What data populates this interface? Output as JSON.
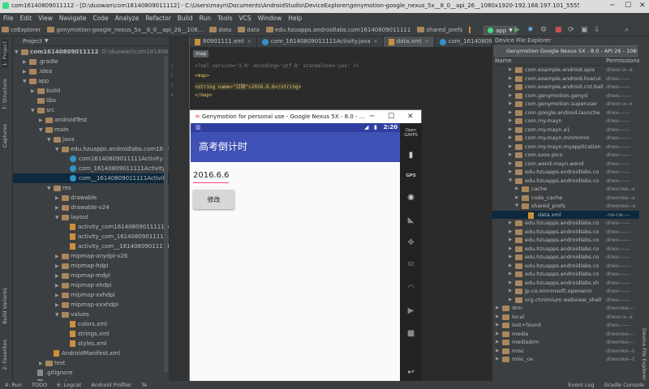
{
  "window_title": "com16140809011112 - [D:\\duowan\\com16140809011112] - C:\\Users\\mayn\\Documents\\AndroidStudio\\DeviceExplorer\\genymotion-google_nexus_5x__8_0__api_26__1080x1920-192.168.197.101_5555\\data\\data\\edu...",
  "menu": [
    "File",
    "Edit",
    "View",
    "Navigate",
    "Code",
    "Analyze",
    "Refactor",
    "Build",
    "Run",
    "Tools",
    "VCS",
    "Window",
    "Help"
  ],
  "nav": [
    "ceExplorer",
    "genymotion-google_nexus_5x__8_0__api_26__108...",
    "data",
    "data",
    "edu.hzuapps.androidlabs.com16140809011111",
    "shared_prefs",
    "data.xml"
  ],
  "run_config": "app",
  "project": {
    "header": "Project",
    "items": [
      {
        "label": "com16140809011112",
        "extra": "D:\\duowan\\com16140809011112",
        "depth": 0,
        "arrow": "▼",
        "icon": "folder"
      },
      {
        "label": ".gradle",
        "depth": 1,
        "arrow": "▶",
        "icon": "folder"
      },
      {
        "label": ".idea",
        "depth": 1,
        "arrow": "▶",
        "icon": "folder"
      },
      {
        "label": "app",
        "depth": 1,
        "arrow": "▼",
        "icon": "folder"
      },
      {
        "label": "build",
        "depth": 2,
        "arrow": "▶",
        "icon": "folder"
      },
      {
        "label": "libs",
        "depth": 2,
        "arrow": "",
        "icon": "folder"
      },
      {
        "label": "src",
        "depth": 2,
        "arrow": "▼",
        "icon": "folder"
      },
      {
        "label": "androidTest",
        "depth": 3,
        "arrow": "▶",
        "icon": "folder"
      },
      {
        "label": "main",
        "depth": 3,
        "arrow": "▼",
        "icon": "folder"
      },
      {
        "label": "java",
        "depth": 4,
        "arrow": "▼",
        "icon": "folder"
      },
      {
        "label": "edu.hzuapps.androidlabs.com16140809011",
        "depth": 5,
        "arrow": "▼",
        "icon": "folder"
      },
      {
        "label": "com16140809011111Activity",
        "depth": 6,
        "arrow": "",
        "icon": "class"
      },
      {
        "label": "com_16140809011111Activity",
        "depth": 6,
        "arrow": "",
        "icon": "class"
      },
      {
        "label": "com__16140809011111Activity",
        "depth": 6,
        "arrow": "",
        "icon": "class",
        "selected": true
      },
      {
        "label": "res",
        "depth": 4,
        "arrow": "▼",
        "icon": "folder"
      },
      {
        "label": "drawable",
        "depth": 5,
        "arrow": "▶",
        "icon": "folder"
      },
      {
        "label": "drawable-v24",
        "depth": 5,
        "arrow": "▶",
        "icon": "folder"
      },
      {
        "label": "layout",
        "depth": 5,
        "arrow": "▼",
        "icon": "folder"
      },
      {
        "label": "activity_com16140809011111.xm",
        "depth": 6,
        "arrow": "",
        "icon": "xml"
      },
      {
        "label": "activity_com_16140809011111.xm",
        "depth": 6,
        "arrow": "",
        "icon": "xml"
      },
      {
        "label": "activity_com__16140809011111.x",
        "depth": 6,
        "arrow": "",
        "icon": "xml"
      },
      {
        "label": "mipmap-anydpi-v26",
        "depth": 5,
        "arrow": "▶",
        "icon": "folder"
      },
      {
        "label": "mipmap-hdpi",
        "depth": 5,
        "arrow": "▶",
        "icon": "folder"
      },
      {
        "label": "mipmap-mdpi",
        "depth": 5,
        "arrow": "▶",
        "icon": "folder"
      },
      {
        "label": "mipmap-xhdpi",
        "depth": 5,
        "arrow": "▶",
        "icon": "folder"
      },
      {
        "label": "mipmap-xxhdpi",
        "depth": 5,
        "arrow": "▶",
        "icon": "folder"
      },
      {
        "label": "mipmap-xxxhdpi",
        "depth": 5,
        "arrow": "▶",
        "icon": "folder"
      },
      {
        "label": "values",
        "depth": 5,
        "arrow": "▼",
        "icon": "folder"
      },
      {
        "label": "colors.xml",
        "depth": 6,
        "arrow": "",
        "icon": "xml"
      },
      {
        "label": "strings.xml",
        "depth": 6,
        "arrow": "",
        "icon": "xml"
      },
      {
        "label": "styles.xml",
        "depth": 6,
        "arrow": "",
        "icon": "xml"
      },
      {
        "label": "AndroidManifest.xml",
        "depth": 4,
        "arrow": "",
        "icon": "xml"
      },
      {
        "label": "test",
        "depth": 3,
        "arrow": "▶",
        "icon": "folder"
      },
      {
        "label": ".gitignore",
        "depth": 2,
        "arrow": "",
        "icon": "file"
      },
      {
        "label": "app.iml",
        "depth": 2,
        "arrow": "",
        "icon": "file"
      }
    ]
  },
  "left_strip": [
    "1: Project",
    "7: Structure",
    "Captures",
    "Build Variants",
    "2: Favorites"
  ],
  "tabs": [
    {
      "label": "80901111.xml",
      "active": false
    },
    {
      "label": "com_16140809011111Activity.java",
      "active": false
    },
    {
      "label": "data.xml",
      "active": true
    },
    {
      "label": "com_16140809011111Activity.java",
      "active": false
    }
  ],
  "editor": {
    "crumb": "map",
    "lines": [
      "1",
      "2",
      "3",
      "4"
    ],
    "code": [
      "<?xml version='1.0' encoding='utf-8' standalone='yes' ?>",
      "<map>",
      "    <string name=\"日期\">2016.6.6</string>",
      "</map>"
    ]
  },
  "emulator": {
    "title": "Genymotion for personal use - Google Nexus 5X - 8.0 - ...",
    "clock": "2:20",
    "app_title": "高考倒计时",
    "date_value": "2016.6.6",
    "button_label": "修改",
    "controls": [
      "Open GAPPS",
      "battery",
      "GPS",
      "camera",
      "wifi",
      "move",
      "ID",
      "rss",
      "media",
      "back"
    ]
  },
  "device": {
    "header": "Device File Explorer",
    "combo": "Genymotion Google Nexus 5X - 8.0 - API 26 - 1080",
    "col_name": "Name",
    "col_perm": "Permissions",
    "rows": [
      {
        "name": "com.example.android.apis",
        "perm": "drwxr-x--x",
        "depth": 2,
        "arrow": "▶"
      },
      {
        "name": "com.example.android.livecul",
        "perm": "drwx------",
        "depth": 2,
        "arrow": "▶"
      },
      {
        "name": "com.example.android.cnt.ball",
        "perm": "drwx------",
        "depth": 2,
        "arrow": "▶"
      },
      {
        "name": "com.genymotion.genyd",
        "perm": "drwx------",
        "depth": 2,
        "arrow": "▶"
      },
      {
        "name": "com.genymotion.superuser",
        "perm": "drwxr-x--x",
        "depth": 2,
        "arrow": "▶"
      },
      {
        "name": "com.google.android.launche",
        "perm": "drwx------",
        "depth": 2,
        "arrow": "▶"
      },
      {
        "name": "com.my.mayn",
        "perm": "drwx------",
        "depth": 2,
        "arrow": "▶"
      },
      {
        "name": "com.my.mayn.a1",
        "perm": "drwx------",
        "depth": 2,
        "arrow": "▶"
      },
      {
        "name": "com.my.mayn.mmmmm",
        "perm": "drwx------",
        "depth": 2,
        "arrow": "▶"
      },
      {
        "name": "com.my.mayn.myapplication",
        "perm": "drwx------",
        "depth": 2,
        "arrow": "▶"
      },
      {
        "name": "com.svox.pico",
        "perm": "drwx------",
        "depth": 2,
        "arrow": "▶"
      },
      {
        "name": "com.wsnd.mayn.wsnd",
        "perm": "drwx------",
        "depth": 2,
        "arrow": "▶"
      },
      {
        "name": "edu.hzuapps.androidlabs.co",
        "perm": "drwx------",
        "depth": 2,
        "arrow": "▶"
      },
      {
        "name": "edu.hzuapps.androidlabs.co",
        "perm": "drwx------",
        "depth": 2,
        "arrow": "▼"
      },
      {
        "name": "cache",
        "perm": "drwxrws--x",
        "depth": 3,
        "arrow": "▶"
      },
      {
        "name": "code_cache",
        "perm": "drwxrws--x",
        "depth": 3,
        "arrow": "▶"
      },
      {
        "name": "shared_prefs",
        "perm": "drwxrwx--x",
        "depth": 3,
        "arrow": "▼"
      },
      {
        "name": "data.xml",
        "perm": "-rw-rw----",
        "depth": 4,
        "arrow": "",
        "selected": true
      },
      {
        "name": "edu.hzuapps.androidlabs.co",
        "perm": "drwx------",
        "depth": 2,
        "arrow": "▶"
      },
      {
        "name": "edu.hzuapps.androidlabs.co",
        "perm": "drwx------",
        "depth": 2,
        "arrow": "▶"
      },
      {
        "name": "edu.hzuapps.androidlabs.co",
        "perm": "drwx------",
        "depth": 2,
        "arrow": "▶"
      },
      {
        "name": "edu.hzuapps.androidlabs.co",
        "perm": "drwx------",
        "depth": 2,
        "arrow": "▶"
      },
      {
        "name": "edu.hzuapps.androidlabs.co",
        "perm": "drwx------",
        "depth": 2,
        "arrow": "▶"
      },
      {
        "name": "edu.hzuapps.androidlabs.co",
        "perm": "drwx------",
        "depth": 2,
        "arrow": "▶"
      },
      {
        "name": "edu.hzuapps.androidlabs.co",
        "perm": "drwx------",
        "depth": 2,
        "arrow": "▶"
      },
      {
        "name": "edu.hzuapps.androidlabs.sh",
        "perm": "drwx------",
        "depth": 2,
        "arrow": "▶"
      },
      {
        "name": "jp.co.omronsoft.openwnn",
        "perm": "drwx------",
        "depth": 2,
        "arrow": "▶"
      },
      {
        "name": "org.chromium.webview_shell",
        "perm": "drwx------",
        "depth": 2,
        "arrow": "▶"
      },
      {
        "name": "drm",
        "perm": "drwxrwx---",
        "depth": 0,
        "arrow": "▶"
      },
      {
        "name": "local",
        "perm": "drwxr-x--x",
        "depth": 0,
        "arrow": "▶"
      },
      {
        "name": "lost+found",
        "perm": "drwx------",
        "depth": 0,
        "arrow": "▶"
      },
      {
        "name": "media",
        "perm": "drwxrwx---",
        "depth": 0,
        "arrow": "▶"
      },
      {
        "name": "mediadrm",
        "perm": "drwxrwx---",
        "depth": 0,
        "arrow": "▶"
      },
      {
        "name": "misc",
        "perm": "drwxrwx--t",
        "depth": 0,
        "arrow": "▶"
      },
      {
        "name": "misc_ce",
        "perm": "drwxrwx--t",
        "depth": 0,
        "arrow": "▶"
      }
    ]
  },
  "right_strip": "Device File Explorer",
  "bottom": [
    "4: Run",
    "TODO",
    "6: Logcat",
    "Android Profiler",
    "Te",
    "Event Log",
    "Gradle Console"
  ]
}
